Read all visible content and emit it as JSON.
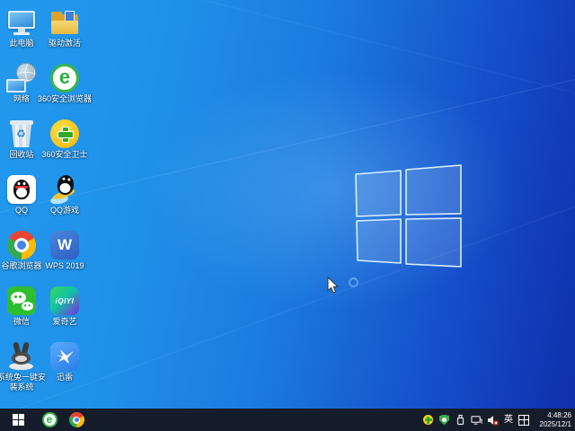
{
  "desktop": {
    "icons": [
      {
        "name": "this-pc",
        "icon": "computer-monitor-icon",
        "label": "此电脑"
      },
      {
        "name": "network",
        "icon": "network-globe-icon",
        "label": "网络"
      },
      {
        "name": "recycle-bin",
        "icon": "recycle-bin-icon",
        "label": "回收站"
      },
      {
        "name": "qq",
        "icon": "qq-penguin-icon",
        "label": "QQ"
      },
      {
        "name": "chrome",
        "icon": "chrome-icon",
        "label": "谷歌浏览器"
      },
      {
        "name": "wechat",
        "icon": "wechat-icon",
        "label": "微信"
      },
      {
        "name": "system-rabbit",
        "icon": "rabbit-icon",
        "label": "系统兔一键安装系统"
      },
      {
        "name": "driver-activation",
        "icon": "folder-driver-icon",
        "label": "驱动激活"
      },
      {
        "name": "360-browser",
        "icon": "360-browser-e-icon",
        "label": "360安全浏览器"
      },
      {
        "name": "360-guard",
        "icon": "360-guard-cross-icon",
        "label": "360安全卫士"
      },
      {
        "name": "qq-games",
        "icon": "qq-game-penguin-icon",
        "label": "QQ游戏"
      },
      {
        "name": "wps",
        "icon": "wps-w-icon",
        "label": "WPS 2019"
      },
      {
        "name": "iqiyi",
        "icon": "iqiyi-icon",
        "label": "爱奇艺"
      },
      {
        "name": "thunder",
        "icon": "thunder-bird-icon",
        "label": "迅雷"
      }
    ],
    "wps_letter": "W",
    "iqiyi_text": "iQIYI",
    "browser_letter": "e",
    "recycle_symbol": "♻"
  },
  "taskbar": {
    "start": "start-button",
    "pinned": [
      {
        "name": "taskbar-360-browser",
        "icon": "360-browser-e-icon"
      },
      {
        "name": "taskbar-chrome",
        "icon": "chrome-icon"
      }
    ],
    "tray": {
      "icons": [
        "360-guard-icon",
        "shield-icon",
        "usb-icon",
        "network-display-icon",
        "volume-muted-icon"
      ],
      "ime_language": "英",
      "ime_keyboard": "keyboard-grid-icon"
    },
    "clock": {
      "time": "4:48:26",
      "date": "2025/12/1"
    }
  },
  "colors": {
    "wallpaper_left": "#2299ee",
    "wallpaper_right": "#1136b4",
    "taskbar_bg": "#151c2a",
    "label_text": "#ffffff"
  }
}
